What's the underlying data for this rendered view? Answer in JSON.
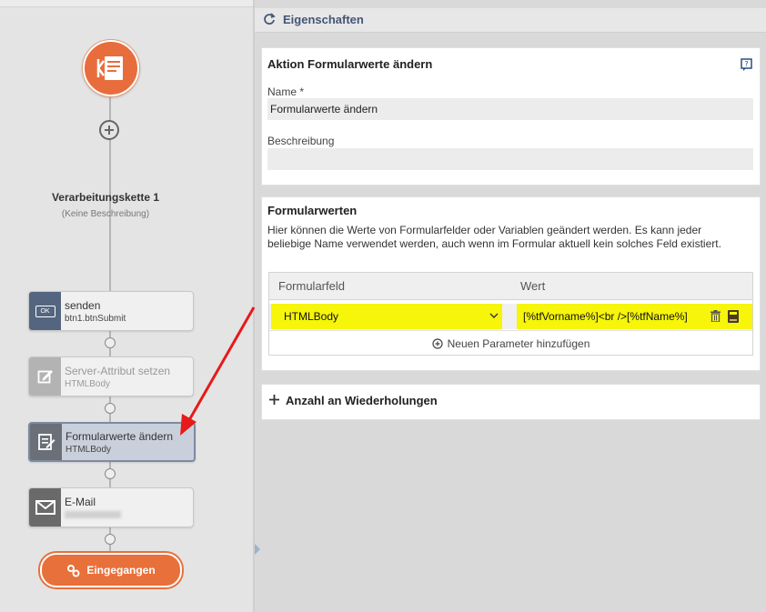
{
  "panel": {
    "title": "Eigenschaften"
  },
  "workflow": {
    "chain_title": "Verarbeitungskette 1",
    "chain_subtitle": "(Keine Beschreibung)",
    "nodes": [
      {
        "title": "senden",
        "subtitle": "btn1.btnSubmit",
        "icon_text": "OK"
      },
      {
        "title": "Server-Attribut setzen",
        "subtitle": "HTMLBody"
      },
      {
        "title": "Formularwerte ändern",
        "subtitle": "HTMLBody"
      },
      {
        "title": "E-Mail",
        "subtitle": ""
      }
    ],
    "end_button": "Eingegangen"
  },
  "action": {
    "title": "Aktion Formularwerte ändern",
    "name_label": "Name",
    "required_mark": "*",
    "name_value": "Formularwerte ändern",
    "description_label": "Beschreibung",
    "description_value": ""
  },
  "form_values": {
    "title": "Formularwerten",
    "description": "Hier können die Werte von Formularfelder oder Variablen geändert werden. Es kann jeder beliebige Name verwendet werden, auch wenn im Formular aktuell kein solches Feld existiert.",
    "columns": [
      "Formularfeld",
      "Wert"
    ],
    "rows": [
      {
        "field": "HTMLBody",
        "value": "[%tfVorname%]<br />[%tfName%]"
      }
    ],
    "add_label": "Neuen Parameter hinzufügen"
  },
  "repetitions": {
    "label": "Anzahl an Wiederholungen"
  },
  "colors": {
    "accent": "#e8703a",
    "highlight": "#f6f50a",
    "header_text": "#445577"
  }
}
